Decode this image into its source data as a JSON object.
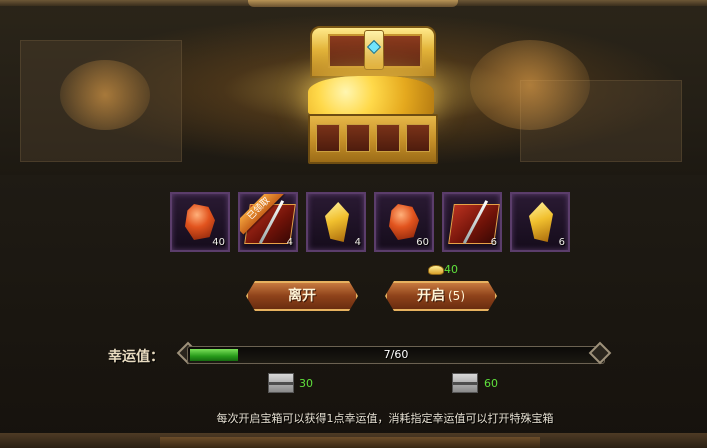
{
  "chest": {
    "name": "treasure-chest"
  },
  "items": [
    {
      "icon": "red-crystal-icon",
      "count": "40",
      "claimed": false
    },
    {
      "icon": "skill-book-icon",
      "count": "4",
      "claimed": true,
      "ribbon_label": "已领取"
    },
    {
      "icon": "yellow-crystal-icon",
      "count": "4",
      "claimed": false
    },
    {
      "icon": "red-crystal-icon",
      "count": "60",
      "claimed": false
    },
    {
      "icon": "skill-book-icon",
      "count": "6",
      "claimed": false
    },
    {
      "icon": "yellow-crystal-icon",
      "count": "6",
      "claimed": false
    }
  ],
  "cost": {
    "icon": "gold-ingot-icon",
    "amount": "40"
  },
  "buttons": {
    "leave_label": "离开",
    "open_label": "开启",
    "open_count": "(5)"
  },
  "luck": {
    "label": "幸运值：",
    "text": "7/60",
    "current": 7,
    "max": 60,
    "color": "#2f9f1f"
  },
  "special_chests": [
    {
      "icon": "silver-chest-icon",
      "required": "30"
    },
    {
      "icon": "silver-chest-icon",
      "required": "60"
    }
  ],
  "tip": "每次开启宝箱可以获得1点幸运值，消耗指定幸运值可以打开特殊宝箱"
}
